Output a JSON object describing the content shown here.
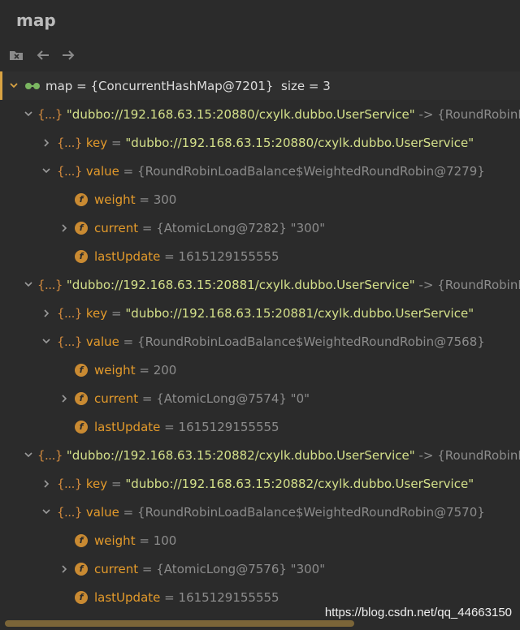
{
  "title": "map",
  "toolbar": {
    "icons": [
      "close-folder-icon",
      "back-arrow-icon",
      "forward-arrow-icon"
    ]
  },
  "root": {
    "name": "map",
    "value": "{ConcurrentHashMap@7201}",
    "size_text": "size = 3"
  },
  "entries": [
    {
      "entry_key": "\"dubbo://192.168.63.15:20880/cxylk.dubbo.UserService\"",
      "entry_arrow": "->",
      "entry_value": "{RoundRobinLoad",
      "key_label": "key",
      "key_value": "\"dubbo://192.168.63.15:20880/cxylk.dubbo.UserService\"",
      "value_label": "value",
      "value_value": "{RoundRobinLoadBalance$WeightedRoundRobin@7279}",
      "weight_label": "weight",
      "weight_value": "300",
      "current_label": "current",
      "current_value": "{AtomicLong@7282} \"300\"",
      "lastupdate_label": "lastUpdate",
      "lastupdate_value": "1615129155555"
    },
    {
      "entry_key": "\"dubbo://192.168.63.15:20881/cxylk.dubbo.UserService\"",
      "entry_arrow": "->",
      "entry_value": "{RoundRobinLoad",
      "key_label": "key",
      "key_value": "\"dubbo://192.168.63.15:20881/cxylk.dubbo.UserService\"",
      "value_label": "value",
      "value_value": "{RoundRobinLoadBalance$WeightedRoundRobin@7568}",
      "weight_label": "weight",
      "weight_value": "200",
      "current_label": "current",
      "current_value": "{AtomicLong@7574} \"0\"",
      "lastupdate_label": "lastUpdate",
      "lastupdate_value": "1615129155555"
    },
    {
      "entry_key": "\"dubbo://192.168.63.15:20882/cxylk.dubbo.UserService\"",
      "entry_arrow": "->",
      "entry_value": "{RoundRobinLoad",
      "key_label": "key",
      "key_value": "\"dubbo://192.168.63.15:20882/cxylk.dubbo.UserService\"",
      "value_label": "value",
      "value_value": "{RoundRobinLoadBalance$WeightedRoundRobin@7570}",
      "weight_label": "weight",
      "weight_value": "100",
      "current_label": "current",
      "current_value": "{AtomicLong@7576} \"300\"",
      "lastupdate_label": "lastUpdate",
      "lastupdate_value": "1615129155555"
    }
  ],
  "labels": {
    "obj": "{...}",
    "f": "f",
    "eq": "="
  },
  "watermark": "https://blog.csdn.net/qq_44663150",
  "colors": {
    "background": "#2b2b2b",
    "string": "#d4e08a",
    "field_name": "#e39a2b",
    "gray_value": "#8c8c8c",
    "accent": "#d9a343"
  }
}
